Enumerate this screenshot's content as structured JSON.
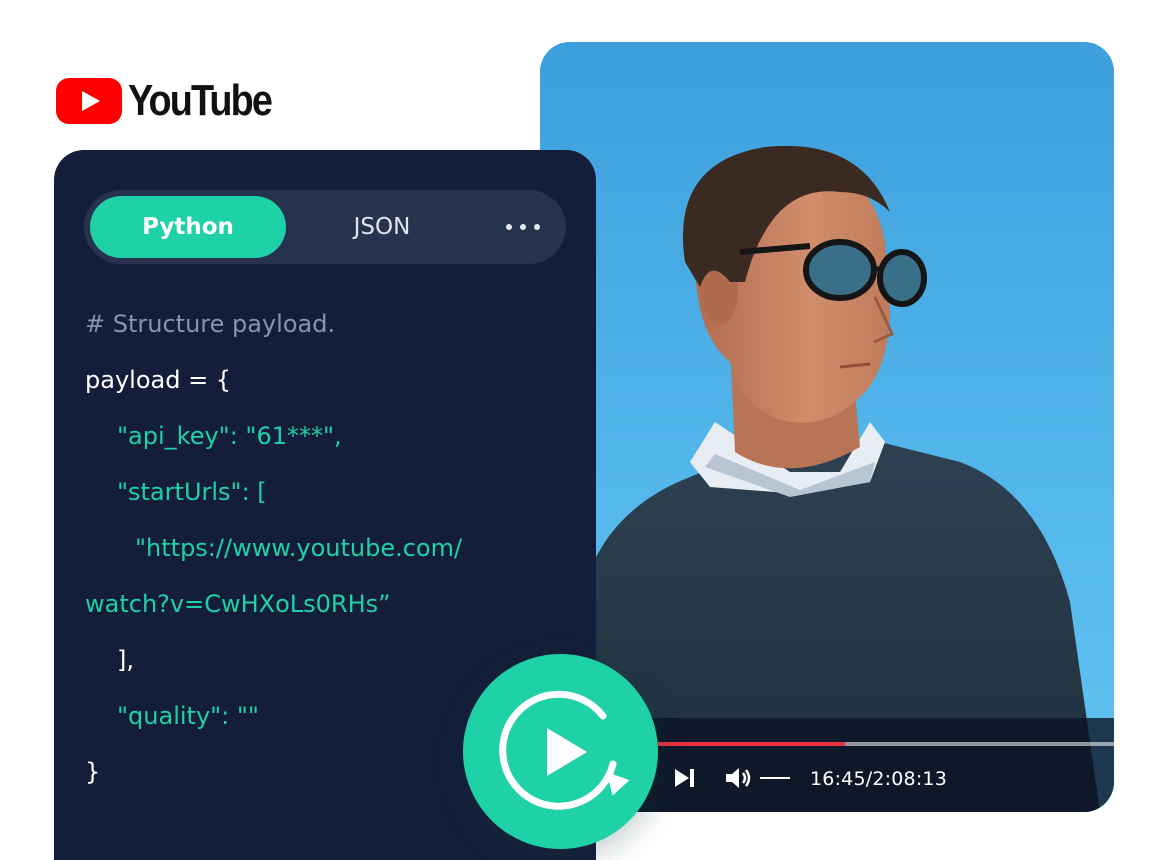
{
  "brand": {
    "logo_text": "YouTube",
    "logo_color": "#ff0000",
    "logo_icon": "youtube-play-icon"
  },
  "code_panel": {
    "tabs": [
      {
        "label": "Python",
        "active": true
      },
      {
        "label": "JSON",
        "active": false
      }
    ],
    "more_icon": "more-dots-icon",
    "lines": [
      {
        "text": "# Structure payload.",
        "kind": "comment",
        "indent": 0
      },
      {
        "text": "payload = {",
        "kind": "plain",
        "indent": 0
      },
      {
        "text": "\"api_key\": \"61***\",",
        "kind": "string",
        "indent": 1
      },
      {
        "text": "\"startUrls\": [",
        "kind": "string",
        "indent": 1
      },
      {
        "text": "\"https://www.youtube.com/",
        "kind": "string",
        "indent": 2
      },
      {
        "text": "watch?v=CwHXoLs0RHs”",
        "kind": "string",
        "indent": 0
      },
      {
        "text": "],",
        "kind": "plain",
        "indent": 1
      },
      {
        "text": "\"quality\": \"\"",
        "kind": "string",
        "indent": 1
      },
      {
        "text": "}",
        "kind": "plain",
        "indent": 0
      }
    ],
    "accent_color": "#1fd1a6",
    "background_color": "#141e3a"
  },
  "video_player": {
    "progress_fraction": 0.41,
    "progress_color": "#e8323f",
    "time_readout": "16:45/2:08:13",
    "next_icon": "skip-next-icon",
    "volume_icon": "volume-icon"
  },
  "action_button": {
    "icon": "refresh-play-icon",
    "color": "#1fd1a6"
  }
}
